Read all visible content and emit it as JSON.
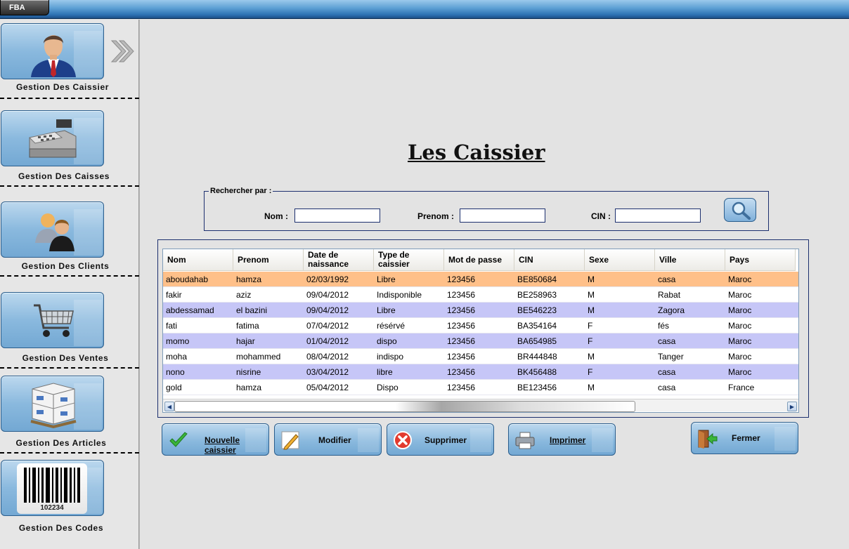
{
  "app": {
    "tab_label": "FBA"
  },
  "sidebar": {
    "items": [
      {
        "label": "Gestion Des Caissier",
        "icon": "cashier-person-icon"
      },
      {
        "label": "Gestion Des Caisses",
        "icon": "cash-register-icon"
      },
      {
        "label": "Gestion Des Clients",
        "icon": "clients-people-icon"
      },
      {
        "label": "Gestion Des Ventes",
        "icon": "shopping-cart-icon"
      },
      {
        "label": "Gestion Des Articles",
        "icon": "boxes-pallet-icon"
      },
      {
        "label": "Gestion Des Codes",
        "icon": "barcode-icon"
      }
    ],
    "barcode_number": "102234"
  },
  "main": {
    "title": "Les Caissier",
    "search": {
      "legend": "Rechercher par :",
      "nom_label": "Nom :",
      "prenom_label": "Prenom :",
      "cin_label": "CIN :",
      "nom_value": "",
      "prenom_value": "",
      "cin_value": ""
    },
    "table": {
      "columns": [
        "Nom",
        "Prenom",
        "Date de naissance",
        "Type de caissier",
        "Mot de passe",
        "CIN",
        "Sexe",
        "Ville",
        "Pays"
      ],
      "rows": [
        [
          "aboudahab",
          "hamza",
          "02/03/1992",
          "Libre",
          "123456",
          "BE850684",
          "M",
          "casa",
          "Maroc"
        ],
        [
          "fakir",
          "aziz",
          "09/04/2012",
          "Indisponible",
          "123456",
          "BE258963",
          "M",
          "Rabat",
          "Maroc"
        ],
        [
          "abdessamad",
          "el bazini",
          "09/04/2012",
          "Libre",
          "123456",
          "BE546223",
          "M",
          "Zagora",
          "Maroc"
        ],
        [
          "fati",
          "fatima",
          "07/04/2012",
          "résérvé",
          "123456",
          "BA354164",
          "F",
          "fés",
          "Maroc"
        ],
        [
          "momo",
          "hajar",
          "01/04/2012",
          "dispo",
          "123456",
          "BA654985",
          "F",
          "casa",
          "Maroc"
        ],
        [
          "moha",
          "mohammed",
          "08/04/2012",
          "indispo",
          "123456",
          "BR444848",
          "M",
          "Tanger",
          "Maroc"
        ],
        [
          "nono",
          "nisrine",
          "03/04/2012",
          "libre",
          "123456",
          "BK456488",
          "F",
          "casa",
          "Maroc"
        ],
        [
          "gold",
          "hamza",
          "05/04/2012",
          "Dispo",
          "123456",
          "BE123456",
          "M",
          "casa",
          "France"
        ]
      ],
      "selected_row": 0
    },
    "actions": {
      "nouvelle": "Nouvelle caissier",
      "modifier": "Modifier",
      "supprimer": "Supprimer",
      "imprimer": "Imprimer",
      "fermer": "Fermer"
    }
  },
  "colors": {
    "selected_row": "#ffc089",
    "alt_row": "#c6c6f7",
    "button_blue": "#8ab9de",
    "border_navy": "#1c2f6e"
  }
}
